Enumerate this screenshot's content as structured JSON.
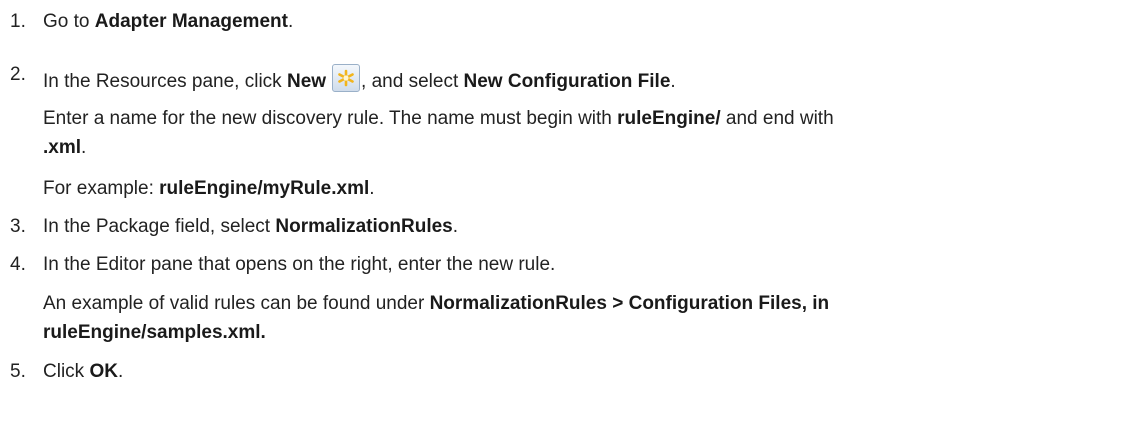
{
  "steps": [
    {
      "number": "1.",
      "text_before": "Go to ",
      "bold": "Adapter Management",
      "text_after": "."
    },
    {
      "number": "2.",
      "text_before": "In the Resources pane, click ",
      "bold_new": "New",
      "icon": "new-star-icon",
      "text_mid": ", and select ",
      "bold": "New Configuration File",
      "text_after": ".",
      "sub_1_before": "Enter a name for the new discovery rule. The name must begin with ",
      "sub_1_bold": "ruleEngine/",
      "sub_1_after": " and end with",
      "sub_1b_bold": ".xml",
      "sub_1b_after": ".",
      "sub_2_before": "For example: ",
      "sub_2_bold": "ruleEngine/myRule.xml",
      "sub_2_after": "."
    },
    {
      "number": "3.",
      "text_before": "In the Package field, select ",
      "bold": "NormalizationRules",
      "text_after": "."
    },
    {
      "number": "4.",
      "text": "In the Editor pane that opens on the right, enter the new rule.",
      "sub_1_before": "An example of valid rules can be found under ",
      "sub_1_bold": "NormalizationRules > Configuration Files, in",
      "sub_1b_bold": "ruleEngine/samples.xml."
    },
    {
      "number": "5.",
      "text_before": "Click ",
      "bold": "OK",
      "text_after": "."
    }
  ],
  "colors": {
    "text": "#222222",
    "icon_star": "#f2b51c"
  }
}
